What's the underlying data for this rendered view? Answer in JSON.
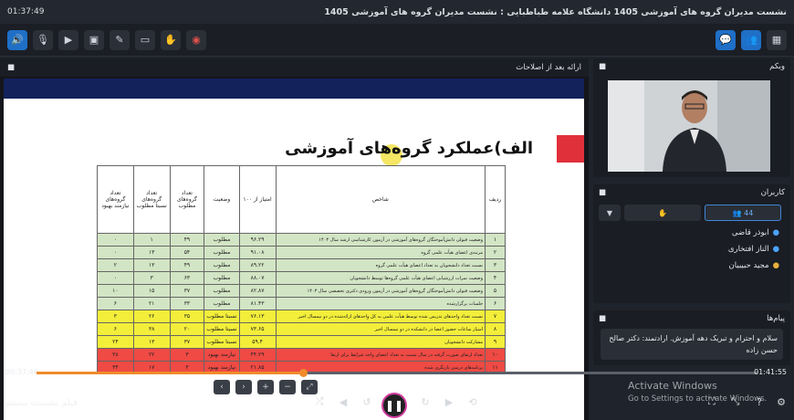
{
  "titlebar": {
    "time": "01:37:49",
    "title": "نشست مدیران گروه های آموزشی 1405  دانشگاه علامه طباطبایی : نشست مدیران گروه های آموزشی 1405"
  },
  "toolbar": {
    "left": [
      "volume-icon",
      "mic-muted-icon",
      "camera-off-icon",
      "screen-share-icon",
      "pen-icon",
      "eraser-icon",
      "hand-icon",
      "record-icon"
    ],
    "right": [
      "chat-icon",
      "users-icon",
      "grid-icon"
    ]
  },
  "presentation": {
    "header": "ارائه بعد از اصلاحات",
    "slide": {
      "title": "الف)عملکرد گروه‌های آموزشی",
      "headers": [
        "ردیف",
        "شاخص",
        "امتیاز از ۱۰۰",
        "وضعیت",
        "تعداد گروه‌های مطلوب",
        "تعداد گروه‌های نسبتا مطلوب",
        "تعداد گروه‌های نیازمند بهبود"
      ],
      "rows": [
        {
          "n": "۱",
          "ind": "وضعیت قبولی دانش‌آموختگان گروه‌های آموزشی در آزمون کارشناسی ارشد سال ۱۴۰۳",
          "score": "۹۶.۲۹",
          "status": "مطلوب",
          "a": "۴۹",
          "b": "۱",
          "c": "۰",
          "cls": "green"
        },
        {
          "n": "۲",
          "ind": "مرتبه‌ی اعضای هیأت علمی گروه",
          "score": "۹۱.۰۸",
          "status": "مطلوب",
          "a": "۵۴",
          "b": "۱۳",
          "c": "۰",
          "cls": "green"
        },
        {
          "n": "۳",
          "ind": "نسبت تعداد دانشجویان به تعداد اعضای هیأت علمی گروه",
          "score": "۸۹.۲۲",
          "status": "مطلوب",
          "a": "۴۹",
          "b": "۱۳",
          "c": "۲",
          "cls": "green"
        },
        {
          "n": "۴",
          "ind": "وضعیت نمرات ارزشیابی اعضای هیأت علمی گروه‌ها توسط دانشجویان",
          "score": "۸۸.۰۷",
          "status": "مطلوب",
          "a": "۶۳",
          "b": "۳",
          "c": "۰",
          "cls": "green"
        },
        {
          "n": "۵",
          "ind": "وضعیت قبولی دانش‌آموختگان گروه‌های آموزشی در آزمون ورودی دکتری تخصصی سال ۱۴۰۳",
          "score": "۸۲.۸۷",
          "status": "مطلوب",
          "a": "۳۷",
          "b": "۱۵",
          "c": "۱۰",
          "cls": "green"
        },
        {
          "n": "۶",
          "ind": "جلسات برگزارشده",
          "score": "۸۱.۴۳",
          "status": "مطلوب",
          "a": "۳۳",
          "b": "۲۱",
          "c": "۶",
          "cls": "green"
        },
        {
          "n": "۷",
          "ind": "نسبت تعداد واحدهای تدریس شده توسط هیأت علمی به کل واحدهای ارائه‌شده در دو نیمسال اخیر",
          "score": "۷۶.۱۳",
          "status": "نسبتا مطلوب",
          "a": "۳۵",
          "b": "۲۶",
          "c": "۳",
          "cls": "yellow"
        },
        {
          "n": "۸",
          "ind": "امتیاز ساعات حضور اعضا در دانشکده در دو نیمسال اخیر",
          "score": "۷۳.۶۵",
          "status": "نسبتا مطلوب",
          "a": "۲۰",
          "b": "۳۸",
          "c": "۶",
          "cls": "yellow"
        },
        {
          "n": "۹",
          "ind": "مشارکت دانشجویان",
          "score": "۵۹.۴",
          "status": "نسبتا مطلوب",
          "a": "۳۷",
          "b": "۱۳",
          "c": "۲۴",
          "cls": "yellow"
        },
        {
          "n": "۱۰",
          "ind": "تعداد ارتقای صورت گرفته در سال نسبت به تعداد اعضای واجد شرایط برای ارتقا",
          "score": "۴۴.۲۹",
          "status": "نیازمند بهبود",
          "a": "۳",
          "b": "۲۲",
          "c": "۳۸",
          "cls": "red"
        },
        {
          "n": "۱۱",
          "ind": "برنامه‌های درسی بازنگری شده",
          "score": "۲۱.۸۵",
          "status": "نیازمند بهبود",
          "a": "۳",
          "b": "۱۷",
          "c": "۳۴",
          "cls": "red"
        }
      ]
    },
    "tools": [
      "chevron-left-icon",
      "chevron-right-icon",
      "zoom-in-icon",
      "zoom-out-icon",
      "fit-icon"
    ]
  },
  "webcam": {
    "header": "وبکم"
  },
  "users": {
    "header": "کاربران",
    "count": "44",
    "list": [
      {
        "name": "ابوذر قاضی"
      },
      {
        "name": "الناز افتخاری"
      },
      {
        "name": "مجید حبیبیان"
      }
    ]
  },
  "messages": {
    "header": "پیام‌ها",
    "text": "سلام و احترام و تبریک دهه آموزش. ارادتمند: دکتر صالح حسن زاده",
    "sender": "سمیه شاه حسینی"
  },
  "player": {
    "elapsed": "00:37:46",
    "total": "01:41:55",
    "progress": 0.37,
    "label": "فیلم نشست بیستم"
  },
  "watermark": {
    "line1": "Activate Windows",
    "line2": "Go to Settings to activate Windows."
  },
  "colors": {
    "accent": "#f08b2b",
    "brand": "#13225a",
    "play_ring": "#d33ea0"
  }
}
